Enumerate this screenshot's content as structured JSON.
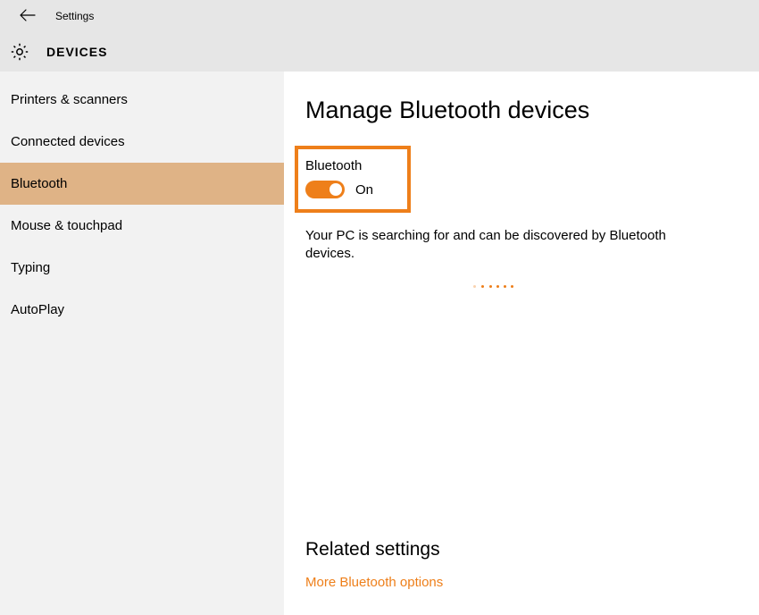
{
  "header": {
    "app_title": "Settings",
    "section_title": "DEVICES"
  },
  "sidebar": {
    "items": [
      {
        "label": "Printers & scanners",
        "active": false
      },
      {
        "label": "Connected devices",
        "active": false
      },
      {
        "label": "Bluetooth",
        "active": true
      },
      {
        "label": "Mouse & touchpad",
        "active": false
      },
      {
        "label": "Typing",
        "active": false
      },
      {
        "label": "AutoPlay",
        "active": false
      }
    ]
  },
  "main": {
    "title": "Manage Bluetooth devices",
    "toggle": {
      "label": "Bluetooth",
      "state_label": "On",
      "on": true
    },
    "status_text": "Your PC is searching for and can be discovered by Bluetooth devices."
  },
  "related": {
    "title": "Related settings",
    "links": [
      {
        "label": "More Bluetooth options"
      }
    ]
  },
  "colors": {
    "accent": "#ee7f1a",
    "sidebar_bg": "#f2f2f2",
    "header_bg": "#e6e6e6",
    "sidebar_active": "#dfb386"
  }
}
